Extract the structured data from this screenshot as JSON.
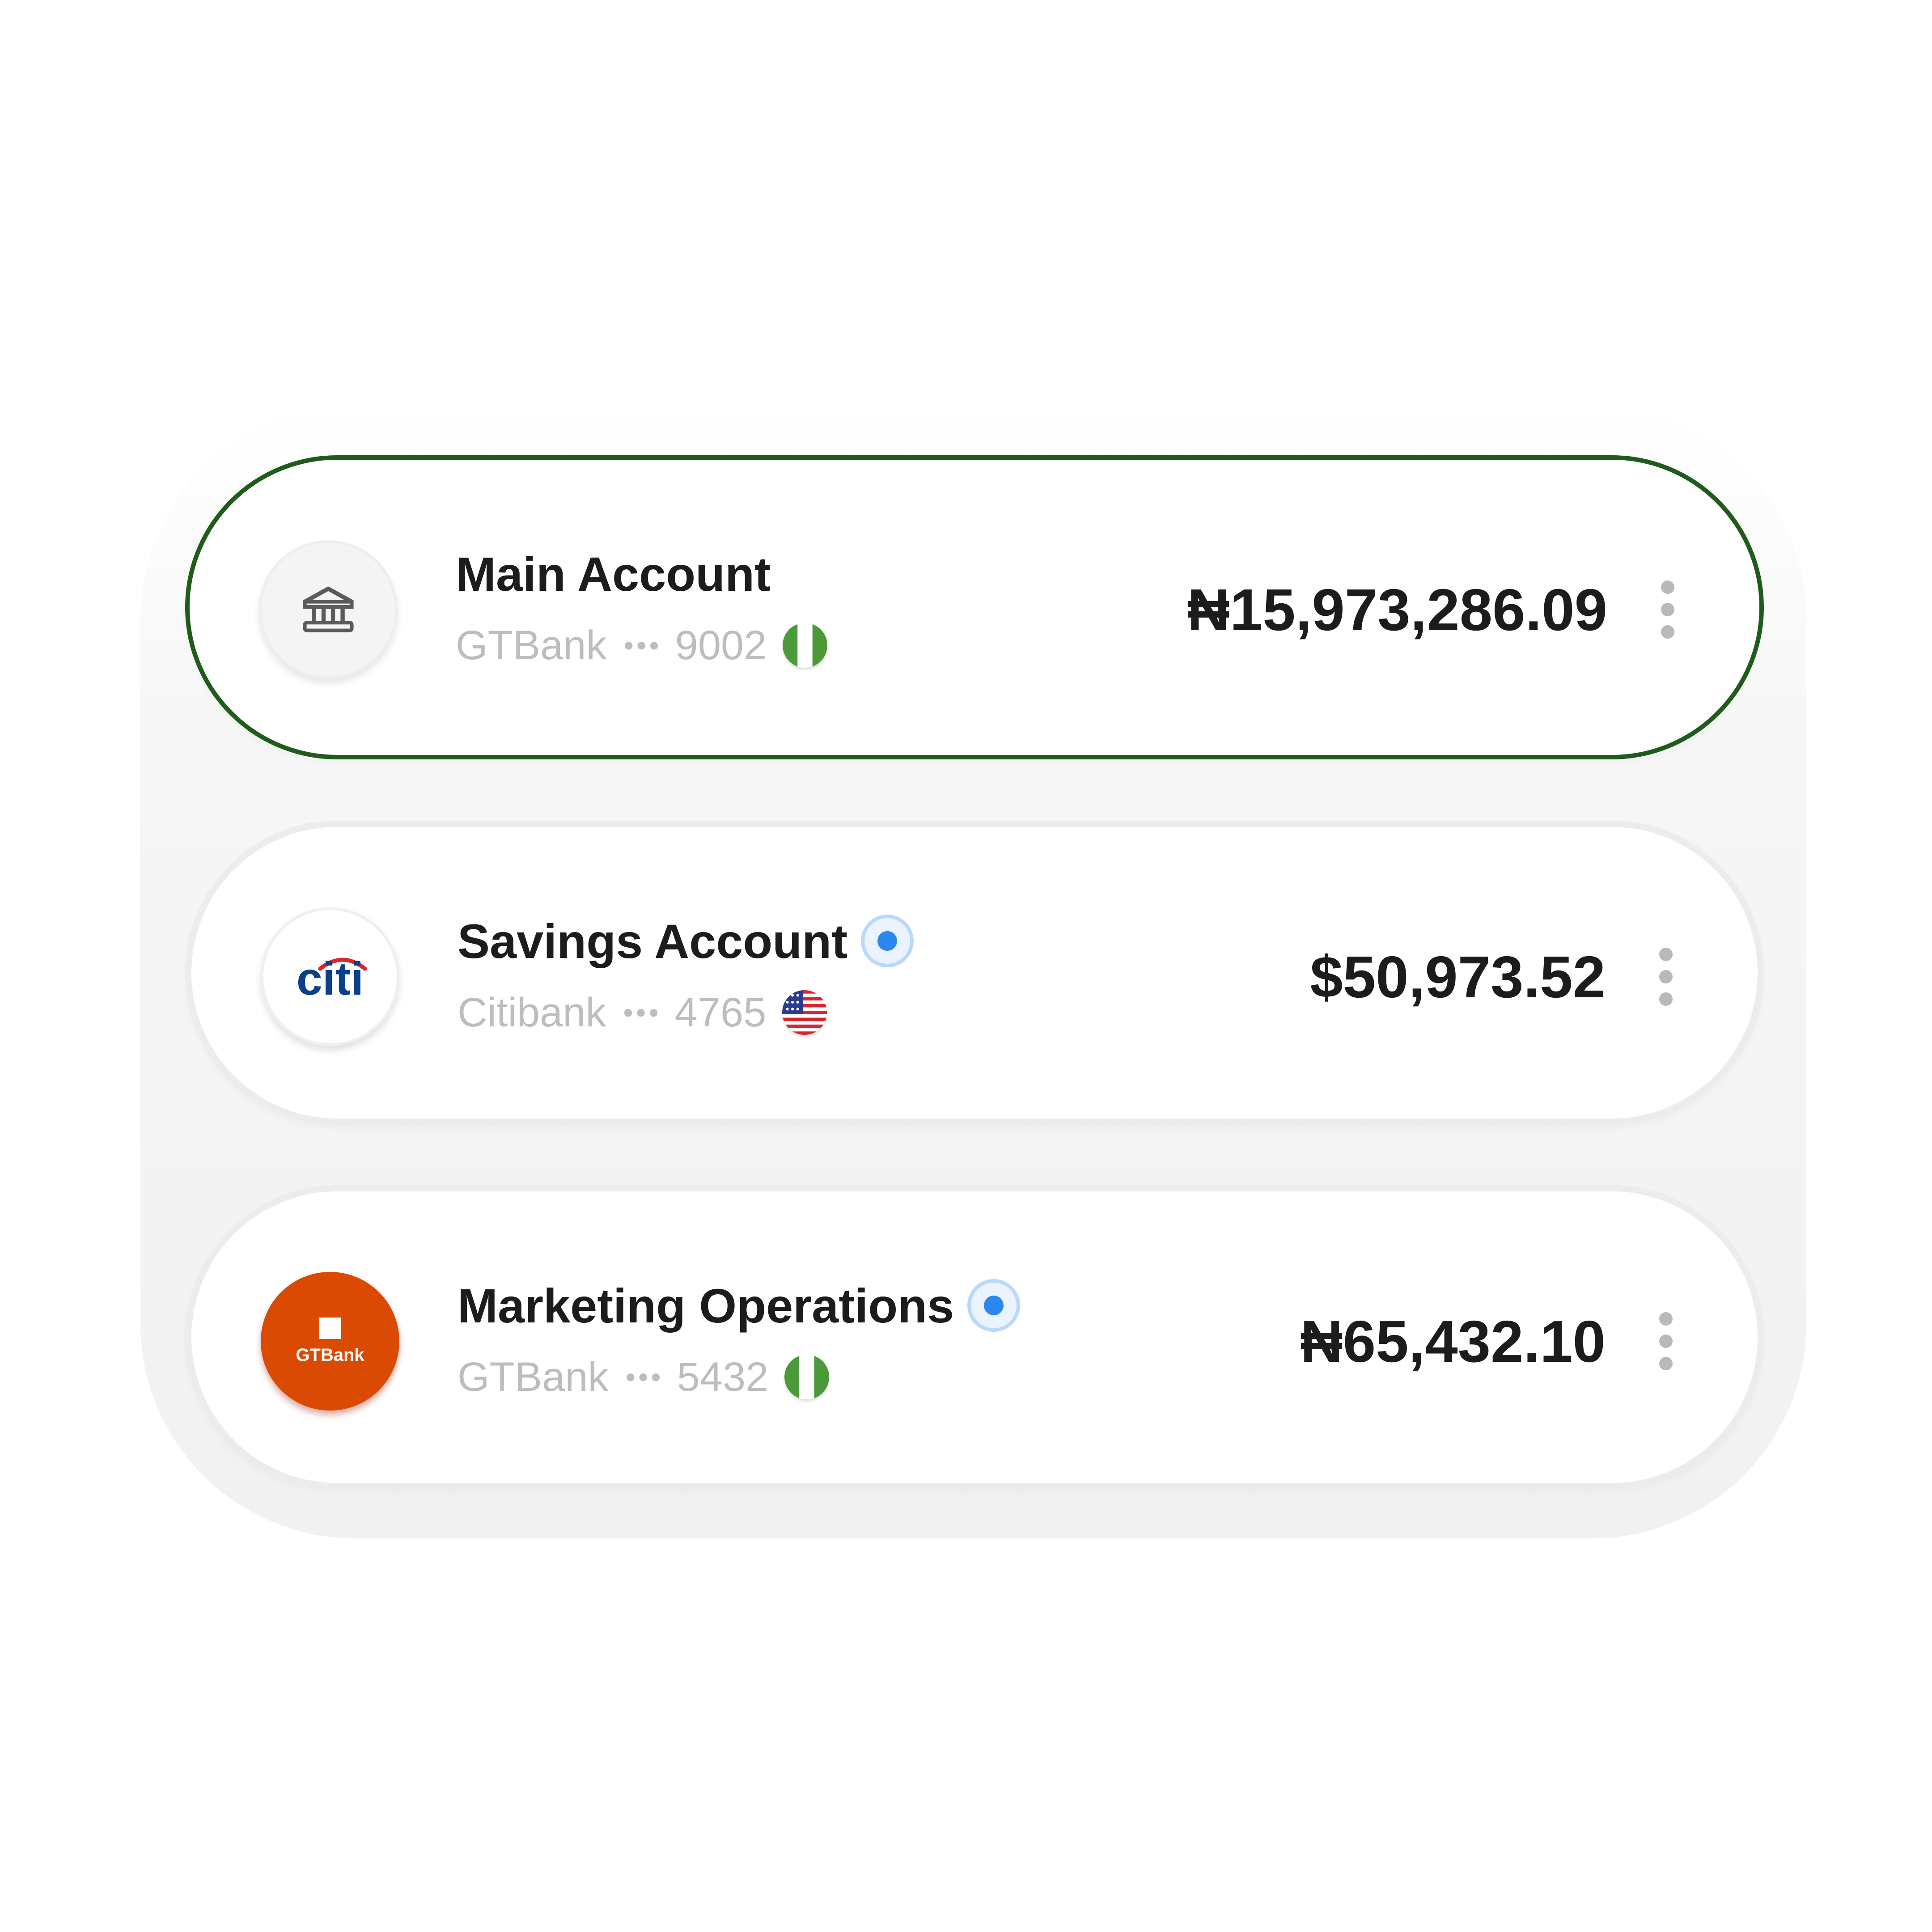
{
  "accounts": [
    {
      "name": "Main Account",
      "bank": "GTBank",
      "masked": "•••",
      "last4": "9002",
      "amount": "₦15,973,286.09",
      "logo_icon": "bank-building-icon",
      "flag_icon": "nigeria-flag-icon",
      "selected": true,
      "verified": false
    },
    {
      "name": "Savings Account",
      "bank": "Citibank",
      "masked": "•••",
      "last4": "4765",
      "amount": "$50,973.52",
      "logo_text": "citi",
      "flag_icon": "usa-flag-icon",
      "selected": false,
      "verified": true
    },
    {
      "name": "Marketing Operations",
      "bank": "GTBank",
      "masked": "•••",
      "last4": "5432",
      "amount": "₦65,432.10",
      "logo_text": "GTBank",
      "flag_icon": "nigeria-flag-icon",
      "selected": false,
      "verified": true
    }
  ],
  "colors": {
    "selected_border": "#1f5c1a",
    "verified_dot": "#2a87ee",
    "gtbank_orange": "#db4a03",
    "citi_blue": "#0a3f8c",
    "citi_arc": "#d8262e",
    "nigeria_green": "#4a9a3a"
  }
}
